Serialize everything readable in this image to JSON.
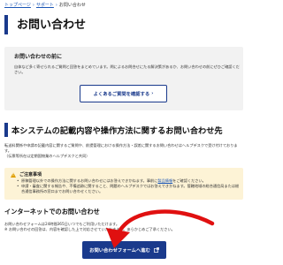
{
  "breadcrumb": {
    "top": "トップページ",
    "support": "サポート",
    "current": "お問い合わせ",
    "separator": "›"
  },
  "page_title": "お問い合わせ",
  "pre_inquiry": {
    "title": "お問い合わせの前に",
    "text": "自体など多く寄せられるご質問と回答をまとめています。問によるお問合せにたる解決策があるか、お問い合わせの前にぜひご確認ください。",
    "button_label": "よくあるご質問を確認する",
    "button_icon": "chevron-right"
  },
  "system_section": {
    "title": "本システムの記載内容や操作方法に関するお問い合わせ先",
    "text_line1": "転送料関係や申請の記載内容に関するご質問や、前提管理における操作方法・誤差に関するお問い合わせはヘルプデスクで受け付けております。",
    "text_line2": "（伝票等所在以定期国物業のヘルプデスクと共同）"
  },
  "notice": {
    "icon": "warning-icon",
    "title": "ご注意事項",
    "items": [
      "原稿管理以外での操作方法に関するお問い合わせにはお答えできかねます。事前に製品情報をご確認ください。",
      "申請・審査に関する報告や、不備追跡に関すること、問題のヘルプデスクではお答えできかねます。管轄地域の総合通信局または総合通信事務所の窓口までお問い合わせください。"
    ],
    "link_text": "製品情報"
  },
  "internet_section": {
    "title": "インターネットでのお問い合わせ",
    "text_line1": "お問い合わせフォームは24時間365日いつでもご利用いただけます。",
    "text_line2": "※ お問い合わせの回答は、内容を確認した上で対応させていただきます。あらかじめご了承ください。"
  },
  "form_button": {
    "label": "お問い合わせフォームへ進む",
    "icon": "external-link-icon"
  },
  "colors": {
    "primary": "#1a3a8c",
    "link": "#1a55b5",
    "notice_bg": "#fdf3d6",
    "box_bg": "#f2f2f2",
    "arrow": "#e01010"
  }
}
